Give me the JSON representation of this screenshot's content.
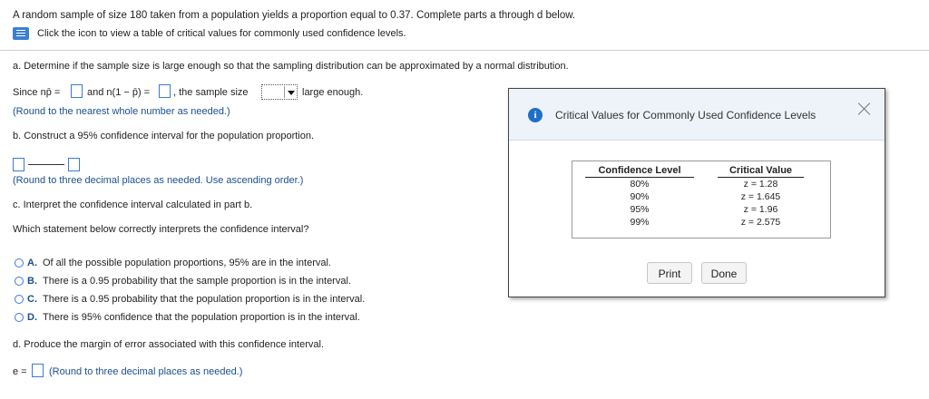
{
  "intro": {
    "problem_text": "A random sample of size 180 taken from a population yields a proportion equal to 0.37. Complete parts a through d below.",
    "icon_link_text": "Click the icon to view a table of critical values for commonly used confidence levels."
  },
  "part_a": {
    "question": "a. Determine if the sample size is large enough so that the sampling distribution can be approximated by a normal distribution.",
    "since_np_label": "Since np̄ =",
    "and_label": "and n(1 − p̄) =",
    "sample_size_label": ", the sample size",
    "large_enough_label": "large enough.",
    "hint": "(Round to the nearest whole number as needed.)"
  },
  "part_b": {
    "question": "b. Construct a 95% confidence interval for the population proportion.",
    "hint": "(Round to three decimal places as needed. Use ascending order.)"
  },
  "part_c": {
    "question": "c. Interpret the confidence interval calculated in part b.",
    "prompt": "Which statement below correctly interprets the confidence interval?",
    "options": [
      {
        "letter": "A.",
        "text": "Of all the possible population proportions, 95% are in the interval."
      },
      {
        "letter": "B.",
        "text": "There is a 0.95 probability that the sample proportion is in the interval."
      },
      {
        "letter": "C.",
        "text": "There is a 0.95 probability that the population proportion is in the interval."
      },
      {
        "letter": "D.",
        "text": "There is 95% confidence that the population proportion is in the interval."
      }
    ]
  },
  "part_d": {
    "question": "d. Produce the margin of error associated with this confidence interval.",
    "e_label": "e =",
    "hint": "(Round to three decimal places as needed.)"
  },
  "modal": {
    "title": "Critical Values for Commonly Used Confidence Levels",
    "info_glyph": "i",
    "table": {
      "headers": [
        "Confidence Level",
        "Critical Value"
      ],
      "rows": [
        [
          "80%",
          "z = 1.28"
        ],
        [
          "90%",
          "z = 1.645"
        ],
        [
          "95%",
          "z = 1.96"
        ],
        [
          "99%",
          "z = 2.575"
        ]
      ]
    },
    "print_label": "Print",
    "done_label": "Done"
  },
  "colors": {
    "accent": "#1a4f8a",
    "input_border": "#3a7bd5",
    "modal_header_bg": "#eef3f9"
  }
}
